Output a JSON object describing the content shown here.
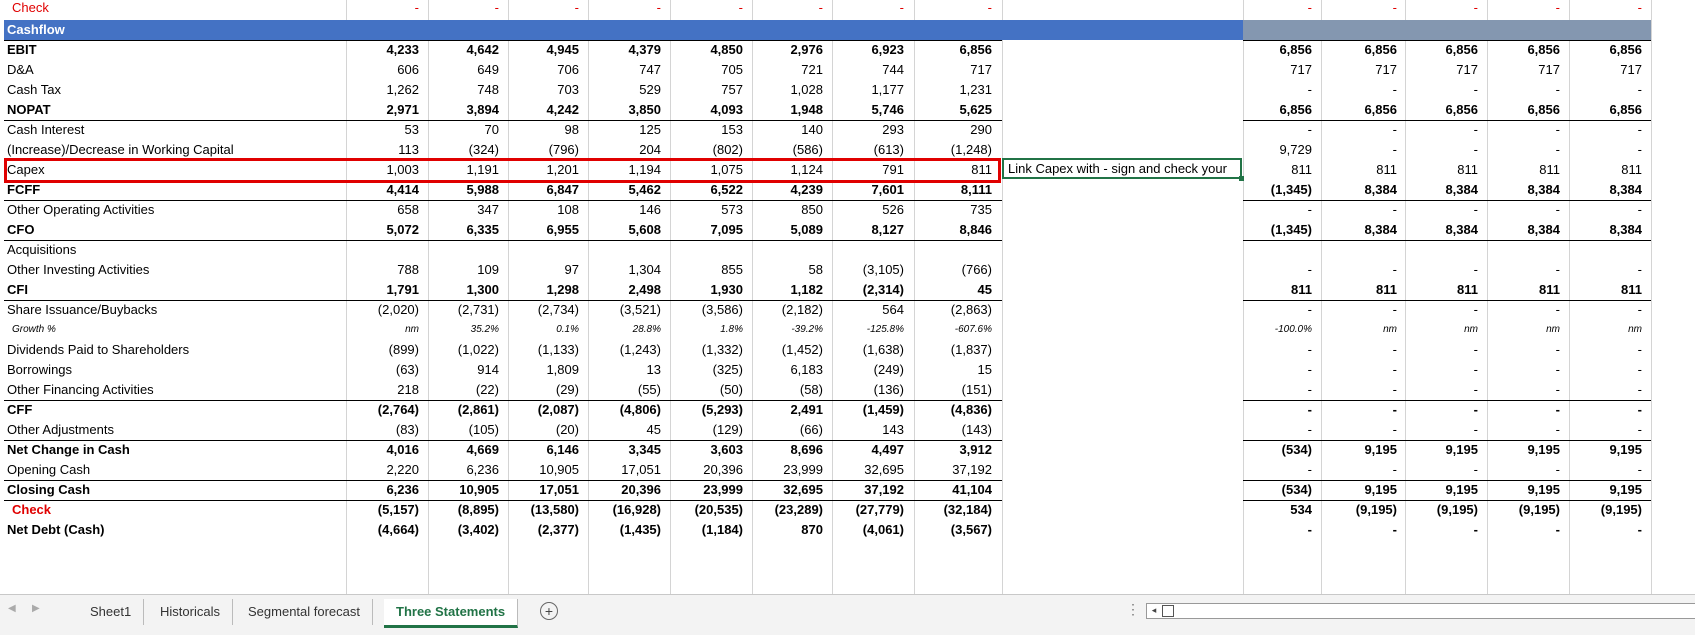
{
  "header": {
    "label": "Cashflow"
  },
  "rows": [
    {
      "label": "Check",
      "style": "red",
      "vals": [
        "-",
        "-",
        "-",
        "-",
        "-",
        "-",
        "-",
        "-"
      ],
      "proj": [
        "-",
        "-",
        "-",
        "-",
        "-"
      ]
    },
    {
      "label": "Cashflow",
      "style": "header",
      "vals": [
        "",
        "",
        "",
        "",
        "",
        "",
        "",
        ""
      ],
      "proj": [
        "",
        "",
        "",
        "",
        ""
      ]
    },
    {
      "label": "EBIT",
      "style": "bold",
      "vals": [
        "4,233",
        "4,642",
        "4,945",
        "4,379",
        "4,850",
        "2,976",
        "6,923",
        "6,856"
      ],
      "proj": [
        "6,856",
        "6,856",
        "6,856",
        "6,856",
        "6,856"
      ]
    },
    {
      "label": "D&A",
      "style": "",
      "vals": [
        "606",
        "649",
        "706",
        "747",
        "705",
        "721",
        "744",
        "717"
      ],
      "proj": [
        "717",
        "717",
        "717",
        "717",
        "717"
      ]
    },
    {
      "label": "Cash Tax",
      "style": "",
      "vals": [
        "1,262",
        "748",
        "703",
        "529",
        "757",
        "1,028",
        "1,177",
        "1,231"
      ],
      "proj": [
        "-",
        "-",
        "-",
        "-",
        "-"
      ]
    },
    {
      "label": "NOPAT",
      "style": "bold",
      "vals": [
        "2,971",
        "3,894",
        "4,242",
        "3,850",
        "4,093",
        "1,948",
        "5,746",
        "5,625"
      ],
      "proj": [
        "6,856",
        "6,856",
        "6,856",
        "6,856",
        "6,856"
      ]
    },
    {
      "label": "Cash Interest",
      "style": "",
      "vals": [
        "53",
        "70",
        "98",
        "125",
        "153",
        "140",
        "293",
        "290"
      ],
      "proj": [
        "-",
        "-",
        "-",
        "-",
        "-"
      ]
    },
    {
      "label": "(Increase)/Decrease in Working Capital",
      "style": "",
      "vals": [
        "113",
        "(324)",
        "(796)",
        "204",
        "(802)",
        "(586)",
        "(613)",
        "(1,248)"
      ],
      "proj": [
        "9,729",
        "-",
        "-",
        "-",
        "-"
      ]
    },
    {
      "label": "Capex",
      "style": "",
      "vals": [
        "1,003",
        "1,191",
        "1,201",
        "1,194",
        "1,075",
        "1,124",
        "791",
        "811"
      ],
      "proj": [
        "811",
        "811",
        "811",
        "811",
        "811"
      ]
    },
    {
      "label": "FCFF",
      "style": "bold",
      "vals": [
        "4,414",
        "5,988",
        "6,847",
        "5,462",
        "6,522",
        "4,239",
        "7,601",
        "8,111"
      ],
      "proj": [
        "(1,345)",
        "8,384",
        "8,384",
        "8,384",
        "8,384"
      ]
    },
    {
      "label": "Other Operating Activities",
      "style": "",
      "vals": [
        "658",
        "347",
        "108",
        "146",
        "573",
        "850",
        "526",
        "735"
      ],
      "proj": [
        "-",
        "-",
        "-",
        "-",
        "-"
      ]
    },
    {
      "label": "CFO",
      "style": "bold",
      "vals": [
        "5,072",
        "6,335",
        "6,955",
        "5,608",
        "7,095",
        "5,089",
        "8,127",
        "8,846"
      ],
      "proj": [
        "(1,345)",
        "8,384",
        "8,384",
        "8,384",
        "8,384"
      ]
    },
    {
      "label": "Acquisitions",
      "style": "",
      "vals": [
        "",
        "",
        "",
        "",
        "",
        "",
        "",
        ""
      ],
      "proj": [
        "",
        "",
        "",
        "",
        ""
      ]
    },
    {
      "label": "Other Investing Activities",
      "style": "",
      "vals": [
        "788",
        "109",
        "97",
        "1,304",
        "855",
        "58",
        "(3,105)",
        "(766)"
      ],
      "proj": [
        "-",
        "-",
        "-",
        "-",
        "-"
      ]
    },
    {
      "label": "CFI",
      "style": "bold",
      "vals": [
        "1,791",
        "1,300",
        "1,298",
        "2,498",
        "1,930",
        "1,182",
        "(2,314)",
        "45"
      ],
      "proj": [
        "811",
        "811",
        "811",
        "811",
        "811"
      ]
    },
    {
      "label": "Share Issuance/Buybacks",
      "style": "",
      "vals": [
        "(2,020)",
        "(2,731)",
        "(2,734)",
        "(3,521)",
        "(3,586)",
        "(2,182)",
        "564",
        "(2,863)"
      ],
      "proj": [
        "-",
        "-",
        "-",
        "-",
        "-"
      ]
    },
    {
      "label": "Growth %",
      "style": "ital",
      "vals": [
        "nm",
        "35.2%",
        "0.1%",
        "28.8%",
        "1.8%",
        "-39.2%",
        "-125.8%",
        "-607.6%"
      ],
      "proj": [
        "-100.0%",
        "nm",
        "nm",
        "nm",
        "nm"
      ]
    },
    {
      "label": "Dividends Paid to Shareholders",
      "style": "",
      "vals": [
        "(899)",
        "(1,022)",
        "(1,133)",
        "(1,243)",
        "(1,332)",
        "(1,452)",
        "(1,638)",
        "(1,837)"
      ],
      "proj": [
        "-",
        "-",
        "-",
        "-",
        "-"
      ]
    },
    {
      "label": "Borrowings",
      "style": "",
      "vals": [
        "(63)",
        "914",
        "1,809",
        "13",
        "(325)",
        "6,183",
        "(249)",
        "15"
      ],
      "proj": [
        "-",
        "-",
        "-",
        "-",
        "-"
      ]
    },
    {
      "label": "Other Financing Activities",
      "style": "",
      "vals": [
        "218",
        "(22)",
        "(29)",
        "(55)",
        "(50)",
        "(58)",
        "(136)",
        "(151)"
      ],
      "proj": [
        "-",
        "-",
        "-",
        "-",
        "-"
      ]
    },
    {
      "label": "CFF",
      "style": "bold",
      "vals": [
        "(2,764)",
        "(2,861)",
        "(2,087)",
        "(4,806)",
        "(5,293)",
        "2,491",
        "(1,459)",
        "(4,836)"
      ],
      "proj": [
        "-",
        "-",
        "-",
        "-",
        "-"
      ]
    },
    {
      "label": "Other Adjustments",
      "style": "",
      "vals": [
        "(83)",
        "(105)",
        "(20)",
        "45",
        "(129)",
        "(66)",
        "143",
        "(143)"
      ],
      "proj": [
        "-",
        "-",
        "-",
        "-",
        "-"
      ]
    },
    {
      "label": "Net Change in Cash",
      "style": "bold",
      "vals": [
        "4,016",
        "4,669",
        "6,146",
        "3,345",
        "3,603",
        "8,696",
        "4,497",
        "3,912"
      ],
      "proj": [
        "(534)",
        "9,195",
        "9,195",
        "9,195",
        "9,195"
      ]
    },
    {
      "label": "Opening Cash",
      "style": "",
      "vals": [
        "2,220",
        "6,236",
        "10,905",
        "17,051",
        "20,396",
        "23,999",
        "32,695",
        "37,192"
      ],
      "proj": [
        "-",
        "-",
        "-",
        "-",
        "-"
      ]
    },
    {
      "label": "Closing Cash",
      "style": "bold",
      "vals": [
        "6,236",
        "10,905",
        "17,051",
        "20,396",
        "23,999",
        "32,695",
        "37,192",
        "41,104"
      ],
      "proj": [
        "(534)",
        "9,195",
        "9,195",
        "9,195",
        "9,195"
      ]
    },
    {
      "label": "Check",
      "style": "redbold",
      "vals": [
        "(5,157)",
        "(8,895)",
        "(13,580)",
        "(16,928)",
        "(20,535)",
        "(23,289)",
        "(27,779)",
        "(32,184)"
      ],
      "proj": [
        "534",
        "(9,195)",
        "(9,195)",
        "(9,195)",
        "(9,195)"
      ]
    },
    {
      "label": "Net Debt (Cash)",
      "style": "bold",
      "vals": [
        "(4,664)",
        "(3,402)",
        "(2,377)",
        "(1,435)",
        "(1,184)",
        "870",
        "(4,061)",
        "(3,567)"
      ],
      "proj": [
        "-",
        "-",
        "-",
        "-",
        "-"
      ]
    }
  ],
  "comment": "Link Capex with - sign and check your",
  "tabs": [
    {
      "label": "Sheet1",
      "active": false
    },
    {
      "label": "Historicals",
      "active": false
    },
    {
      "label": "Segmental forecast",
      "active": false
    },
    {
      "label": "Three Statements",
      "active": true
    }
  ],
  "colors": {
    "header": "#4472c4",
    "header_projection": "#8497b0",
    "check": "#e00000",
    "active_tab": "#217346"
  },
  "icons": {
    "add_sheet": "plus-circle-icon",
    "scroll_left": "triangle-left-icon",
    "scroll_right": "triangle-right-icon"
  }
}
